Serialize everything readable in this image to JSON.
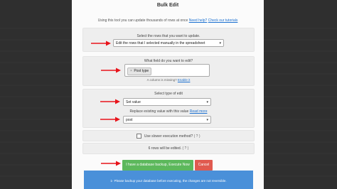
{
  "modal": {
    "title": "Bulk Edit",
    "intro_text": "Using this tool you can update thousands of rows at once",
    "intro_link_help": "Need help?",
    "intro_link_tutorials": "Check our tutorials"
  },
  "rows_section": {
    "label": "Select the rows that you want to update.",
    "selected_option": "Edit the rows that I selected manually in the spreadsheet"
  },
  "field_section": {
    "label": "What field do you want to edit?",
    "chip_remove": "×",
    "chip_value": "Post type",
    "missing_text": "A column is missing?",
    "enable_link": "Enable it"
  },
  "edit_section": {
    "label": "Select type of edit",
    "type_value": "Set value",
    "replace_label": "Replace existing value with this value",
    "read_more": "Read more",
    "value": "post"
  },
  "slower": {
    "label": "Use slower execution method?",
    "help": "( ? )"
  },
  "rows_count": {
    "text": "6 rows will be edited.",
    "help": "( ? )"
  },
  "buttons": {
    "execute": "I have a database backup, Execute Now",
    "cancel": "Cancel"
  },
  "notice": {
    "text": "1- Please backup your database before executing, the changes are not reversible."
  },
  "colors": {
    "arrow": "#e8141b",
    "execute": "#5cb85c",
    "cancel": "#e05a4f",
    "link": "#1a6fd0",
    "notice": "#4a90d9"
  },
  "icons": {
    "select_caret": "chevron-down-icon",
    "annotation_arrow": "arrow-right-icon"
  }
}
